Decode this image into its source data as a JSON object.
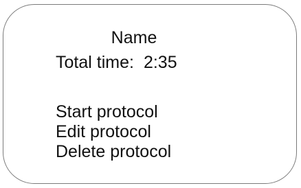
{
  "protocol": {
    "name": "Name",
    "total_time_label": "Total time:",
    "total_time_value": "2:35"
  },
  "menu": {
    "items": [
      {
        "label": "Start protocol"
      },
      {
        "label": "Edit protocol"
      },
      {
        "label": "Delete protocol"
      }
    ]
  }
}
